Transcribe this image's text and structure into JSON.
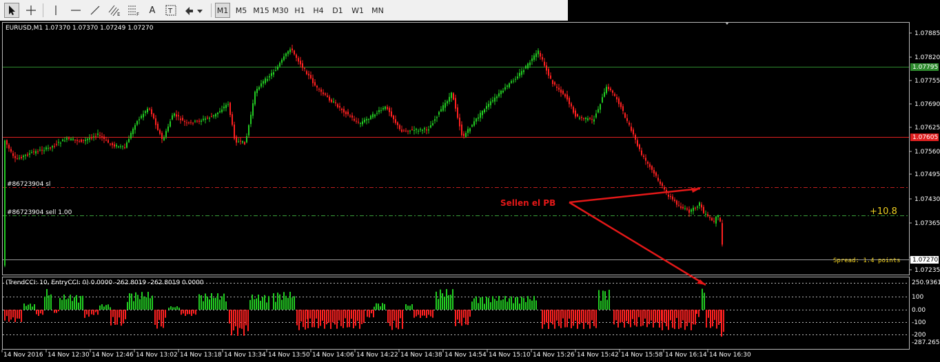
{
  "toolbar": {
    "tools": [
      {
        "name": "cursor-tool",
        "label": ""
      },
      {
        "name": "crosshair-tool",
        "label": ""
      },
      {
        "name": "vertical-line-tool",
        "label": ""
      },
      {
        "name": "horizontal-line-tool",
        "label": ""
      },
      {
        "name": "trendline-tool",
        "label": ""
      },
      {
        "name": "equidistant-channel-tool",
        "label": "E"
      },
      {
        "name": "fibonacci-tool",
        "label": "F"
      },
      {
        "name": "text-tool",
        "label": "A"
      },
      {
        "name": "text-label-tool",
        "label": "T"
      },
      {
        "name": "arrows-tool",
        "label": ""
      }
    ],
    "timeframes": [
      "M1",
      "M5",
      "M15",
      "M30",
      "H1",
      "H4",
      "D1",
      "W1",
      "MN"
    ],
    "active_timeframe": "M1"
  },
  "chart": {
    "header": "EURUSD,M1  1.07370 1.07370 1.07249 1.07270",
    "price_labels": [
      "1.07885",
      "1.07820",
      "1.07755",
      "1.07690",
      "1.07625",
      "1.07560",
      "1.07495",
      "1.07430",
      "1.07365",
      "1.07270",
      "1.07235"
    ],
    "level_green": "1.07795",
    "level_red": "1.07605",
    "current_price": "1.07270",
    "sl_label": "#86723904 sl",
    "sell_label": "#86723904 sell 1.00",
    "profit": "+10.8",
    "spread": "Spread: 1.4 points",
    "annotation": "Sellen el PB",
    "colors": {
      "bull": "#22cc22",
      "bear": "#ff2020",
      "grid_green": "#2e8b2e",
      "grid_red": "#e02020",
      "annotation": "#e41818",
      "profit": "#f0d020",
      "bg": "#000000"
    }
  },
  "indicator": {
    "header": "(TrendCCI: 10, EntryCCI: 0)  0.0000 -262.8019 -262.8019 0.0000",
    "labels": [
      "250.9361",
      "100",
      "0.00",
      "-100",
      "-200",
      "-287.2656"
    ]
  },
  "time_axis": [
    "14 Nov 2016",
    "14 Nov 12:30",
    "14 Nov 12:46",
    "14 Nov 13:02",
    "14 Nov 13:18",
    "14 Nov 13:34",
    "14 Nov 13:50",
    "14 Nov 14:06",
    "14 Nov 14:22",
    "14 Nov 14:38",
    "14 Nov 14:54",
    "14 Nov 15:10",
    "14 Nov 15:26",
    "14 Nov 15:42",
    "14 Nov 15:58",
    "14 Nov 16:14",
    "14 Nov 16:30"
  ]
}
